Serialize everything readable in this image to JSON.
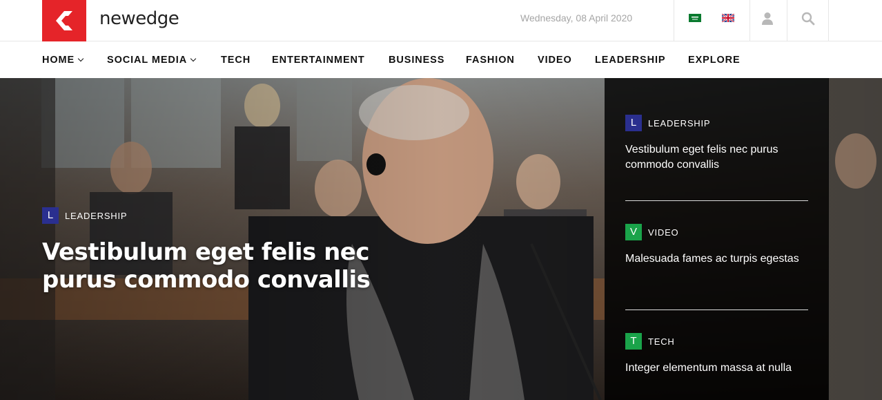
{
  "header": {
    "site_name": "newedge",
    "date": "Wednesday, 08 April 2020",
    "brand_color": "#e52429"
  },
  "nav": {
    "items": [
      {
        "label": "HOME",
        "dropdown": true
      },
      {
        "label": "SOCIAL MEDIA",
        "dropdown": true
      },
      {
        "label": "TECH",
        "dropdown": false
      },
      {
        "label": "ENTERTAINMENT",
        "dropdown": false
      },
      {
        "label": "BUSINESS",
        "dropdown": false
      },
      {
        "label": "FASHION",
        "dropdown": false
      },
      {
        "label": "VIDEO",
        "dropdown": false
      },
      {
        "label": "LEADERSHIP",
        "dropdown": false
      },
      {
        "label": "EXPLORE",
        "dropdown": false
      }
    ]
  },
  "hero": {
    "badge": "L",
    "category": "LEADERSHIP",
    "title": "Vestibulum eget felis nec purus commodo convallis"
  },
  "sidebar": {
    "items": [
      {
        "badge": "L",
        "category": "LEADERSHIP",
        "title": "Vestibulum eget felis nec purus commodo convallis",
        "badge_color": "#2a2f8f"
      },
      {
        "badge": "V",
        "category": "VIDEO",
        "title": "Malesuada fames ac turpis egestas",
        "badge_color": "#1aa34a"
      },
      {
        "badge": "T",
        "category": "TECH",
        "title": "Integer elementum massa at nulla",
        "badge_color": "#1aa34a"
      }
    ]
  }
}
